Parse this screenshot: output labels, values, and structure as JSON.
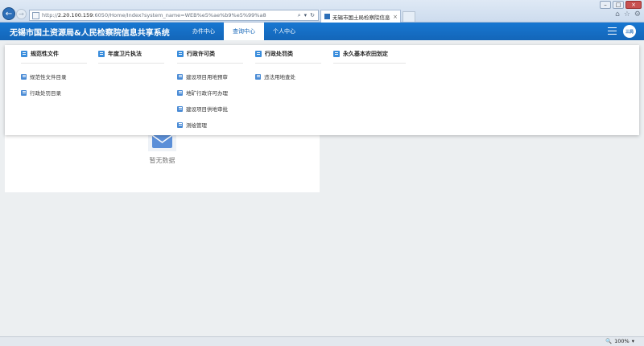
{
  "browser": {
    "url_prefix": "http://",
    "url_host": "2.20.100.159",
    "url_rest": ":6050/Home/Index?system_name=WEB%e5%ae%b9%e5%99%a8",
    "tab_title": "无锡市国土局检察院信息共...",
    "search_glyph": "⌕",
    "dropdown_glyph": "▾",
    "refresh_glyph": "↻",
    "back_glyph": "←",
    "forward_glyph": "→",
    "close_glyph": "×",
    "home_glyph": "⌂",
    "star_glyph": "☆",
    "gear_glyph": "⚙",
    "zoom": "100%"
  },
  "header": {
    "title": "无锡市国土资源局&人民检察院信息共享系统",
    "nav": [
      {
        "label": "办件中心"
      },
      {
        "label": "查询中心"
      },
      {
        "label": "个人中心"
      }
    ],
    "avatar_text": "三局"
  },
  "mega_menu": {
    "columns": [
      {
        "title": "规范性文件",
        "items": [
          "规范性文件目录",
          "行政处罚目录"
        ]
      },
      {
        "title": "年度卫片执法",
        "items": []
      },
      {
        "title": "行政许可类",
        "items": [
          "建设项目用地预审",
          "地矿行政许可办理",
          "建设项目供地审批",
          "测绘管理"
        ]
      },
      {
        "title": "行政处罚类",
        "items": [
          "违法用地查处"
        ]
      },
      {
        "title": "永久基本农田划定",
        "items": []
      }
    ]
  },
  "content": {
    "empty_text": "暂无数据"
  },
  "colors": {
    "brand_blue": "#1466b8",
    "icon_blue": "#3a8ddc"
  }
}
